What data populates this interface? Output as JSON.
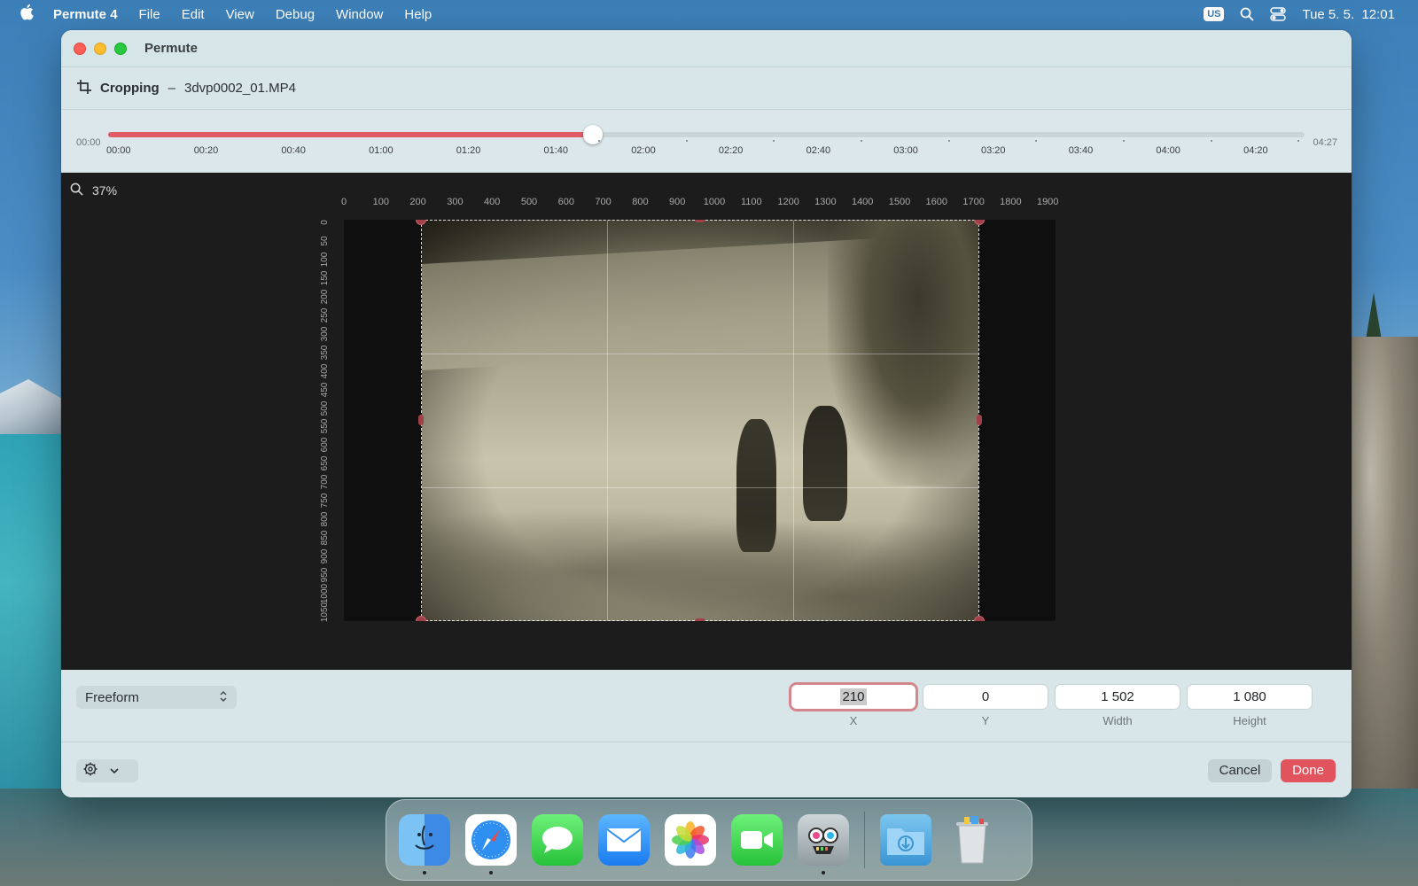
{
  "menubar": {
    "app_name": "Permute 4",
    "items": [
      "File",
      "Edit",
      "View",
      "Debug",
      "Window",
      "Help"
    ],
    "keyboard_badge": "US",
    "datetime": "Tue 5. 5.  12:01"
  },
  "window": {
    "title": "Permute"
  },
  "crop_header": {
    "mode_label": "Cropping",
    "separator": "–",
    "filename": "3dvp0002_01.MP4"
  },
  "timeline": {
    "start_time": "00:00",
    "end_time": "04:27",
    "progress": 0.405,
    "tick_labels": [
      "00:00",
      "00:20",
      "00:40",
      "01:00",
      "01:20",
      "01:40",
      "02:00",
      "02:20",
      "02:40",
      "03:00",
      "03:20",
      "03:40",
      "04:00",
      "04:20"
    ]
  },
  "canvas": {
    "zoom": "37%",
    "ruler_top": [
      "0",
      "100",
      "200",
      "300",
      "400",
      "500",
      "600",
      "700",
      "800",
      "900",
      "1000",
      "1100",
      "1200",
      "1300",
      "1400",
      "1500",
      "1600",
      "1700",
      "1800",
      "1900"
    ],
    "ruler_left": [
      "0",
      "50",
      "100",
      "150",
      "200",
      "250",
      "300",
      "350",
      "400",
      "450",
      "500",
      "550",
      "600",
      "650",
      "700",
      "750",
      "800",
      "850",
      "900",
      "950",
      "1000",
      "1050"
    ]
  },
  "controls": {
    "aspect_select": "Freeform",
    "x_value": "210",
    "y_value": "0",
    "width_value": "1 502",
    "height_value": "1 080",
    "x_label": "X",
    "y_label": "Y",
    "width_label": "Width",
    "height_label": "Height"
  },
  "footer": {
    "cancel_label": "Cancel",
    "done_label": "Done"
  },
  "colors": {
    "accent": "#e1545d",
    "handle": "#a2404a"
  },
  "dock": {
    "apps": [
      "finder-icon",
      "safari-icon",
      "messages-icon",
      "mail-icon",
      "photos-icon",
      "facetime-icon",
      "permute-icon",
      "downloads-folder-icon",
      "trash-icon"
    ]
  }
}
